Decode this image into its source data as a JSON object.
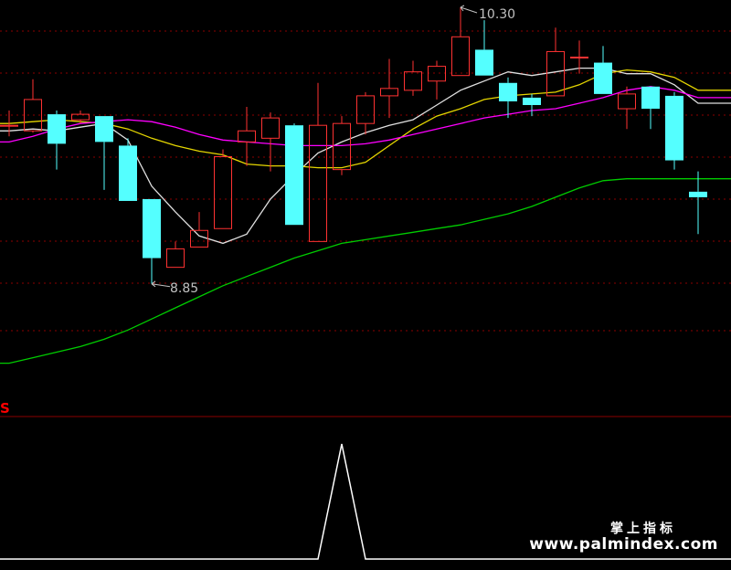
{
  "colors": {
    "background": "#000000",
    "up_candle": "#ff3232",
    "down_candle": "#54ffff",
    "grid": "#8b0000",
    "ma_white": "#e0e0e0",
    "ma_yellow": "#e5d600",
    "ma_magenta": "#ff00ff",
    "ma_green": "#00cc00",
    "indicator_line": "#ffffff",
    "label_text": "#c0c0c0",
    "panel_separator": "#8b0000",
    "indicator_marker": "#ff0000"
  },
  "labels": {
    "high_label": "10.30",
    "low_label": "8.85",
    "indicator_marker": "S"
  },
  "watermark": {
    "chinese": "掌上指标",
    "url": "www.palmindex.com"
  },
  "chart_data": [
    {
      "type": "candlestick",
      "price_range": [
        8.21,
        10.35
      ],
      "candles": [
        {
          "o": 9.71,
          "c": 9.71,
          "h": 9.79,
          "l": 9.65
        },
        {
          "o": 9.68,
          "c": 9.85,
          "h": 9.96,
          "l": 9.67
        },
        {
          "o": 9.77,
          "c": 9.61,
          "h": 9.79,
          "l": 9.47
        },
        {
          "o": 9.74,
          "c": 9.77,
          "h": 9.79,
          "l": 9.72
        },
        {
          "o": 9.76,
          "c": 9.62,
          "h": 9.76,
          "l": 9.36
        },
        {
          "o": 9.6,
          "c": 9.3,
          "h": 9.64,
          "l": 9.3
        },
        {
          "o": 9.31,
          "c": 8.99,
          "h": 9.31,
          "l": 8.85
        },
        {
          "o": 8.94,
          "c": 9.04,
          "h": 9.08,
          "l": 8.94
        },
        {
          "o": 9.05,
          "c": 9.14,
          "h": 9.24,
          "l": 9.05
        },
        {
          "o": 9.15,
          "c": 9.54,
          "h": 9.58,
          "l": 9.15
        },
        {
          "o": 9.62,
          "c": 9.68,
          "h": 9.81,
          "l": 9.49
        },
        {
          "o": 9.64,
          "c": 9.75,
          "h": 9.78,
          "l": 9.46
        },
        {
          "o": 9.71,
          "c": 9.17,
          "h": 9.72,
          "l": 9.17
        },
        {
          "o": 9.08,
          "c": 9.71,
          "h": 9.94,
          "l": 9.08
        },
        {
          "o": 9.47,
          "c": 9.72,
          "h": 9.76,
          "l": 9.44
        },
        {
          "o": 9.72,
          "c": 9.87,
          "h": 9.89,
          "l": 9.66
        },
        {
          "o": 9.87,
          "c": 9.91,
          "h": 10.07,
          "l": 9.75
        },
        {
          "o": 9.9,
          "c": 10.0,
          "h": 10.06,
          "l": 9.87
        },
        {
          "o": 9.95,
          "c": 10.03,
          "h": 10.06,
          "l": 9.85
        },
        {
          "o": 9.98,
          "c": 10.19,
          "h": 10.35,
          "l": 9.98
        },
        {
          "o": 10.12,
          "c": 9.98,
          "h": 10.28,
          "l": 9.98
        },
        {
          "o": 9.94,
          "c": 9.84,
          "h": 9.97,
          "l": 9.75
        },
        {
          "o": 9.86,
          "c": 9.82,
          "h": 9.88,
          "l": 9.76
        },
        {
          "o": 9.87,
          "c": 10.11,
          "h": 10.24,
          "l": 9.87
        },
        {
          "o": 10.08,
          "c": 10.08,
          "h": 10.17,
          "l": 9.99
        },
        {
          "o": 10.05,
          "c": 9.88,
          "h": 10.14,
          "l": 9.88
        },
        {
          "o": 9.8,
          "c": 9.88,
          "h": 9.92,
          "l": 9.69
        },
        {
          "o": 9.92,
          "c": 9.8,
          "h": 9.92,
          "l": 9.69
        },
        {
          "o": 9.87,
          "c": 9.52,
          "h": 9.89,
          "l": 9.47
        },
        {
          "o": 9.35,
          "c": 9.32,
          "h": 9.46,
          "l": 9.12
        }
      ],
      "moving_averages": [
        {
          "color_key": "ma_white",
          "values": [
            9.68,
            9.69,
            9.68,
            9.7,
            9.72,
            9.63,
            9.38,
            9.24,
            9.11,
            9.07,
            9.12,
            9.31,
            9.44,
            9.56,
            9.62,
            9.67,
            9.71,
            9.74,
            9.82,
            9.9,
            9.95,
            10.0,
            9.98,
            10.0,
            10.02,
            10.02,
            9.99,
            9.99,
            9.93,
            9.83
          ]
        },
        {
          "color_key": "ma_yellow",
          "values": [
            9.72,
            9.73,
            9.74,
            9.73,
            9.72,
            9.69,
            9.64,
            9.6,
            9.57,
            9.55,
            9.5,
            9.49,
            9.49,
            9.48,
            9.48,
            9.51,
            9.6,
            9.69,
            9.76,
            9.8,
            9.85,
            9.87,
            9.88,
            9.89,
            9.93,
            9.99,
            10.01,
            10.0,
            9.97,
            9.9
          ]
        },
        {
          "color_key": "ma_magenta",
          "values": [
            9.62,
            9.65,
            9.69,
            9.72,
            9.73,
            9.74,
            9.73,
            9.7,
            9.66,
            9.63,
            9.62,
            9.61,
            9.6,
            9.6,
            9.6,
            9.61,
            9.63,
            9.66,
            9.69,
            9.72,
            9.75,
            9.77,
            9.79,
            9.8,
            9.83,
            9.86,
            9.9,
            9.92,
            9.9,
            9.86
          ]
        },
        {
          "color_key": "ma_green",
          "values": [
            8.42,
            8.45,
            8.48,
            8.51,
            8.55,
            8.6,
            8.66,
            8.72,
            8.78,
            8.84,
            8.89,
            8.94,
            8.99,
            9.03,
            9.07,
            9.09,
            9.11,
            9.13,
            9.15,
            9.17,
            9.2,
            9.23,
            9.27,
            9.32,
            9.37,
            9.41,
            9.42,
            9.42,
            9.42,
            9.42
          ]
        }
      ]
    },
    {
      "type": "line",
      "series": [
        {
          "color_key": "indicator_line",
          "values": [
            0,
            0,
            0,
            0,
            0,
            0,
            0,
            0,
            0,
            0,
            0,
            0,
            0,
            0,
            1,
            0,
            0,
            0,
            0,
            0,
            0,
            0,
            0,
            0,
            0,
            0,
            0,
            0,
            0,
            0
          ]
        }
      ],
      "ylim": [
        0,
        1
      ]
    }
  ]
}
